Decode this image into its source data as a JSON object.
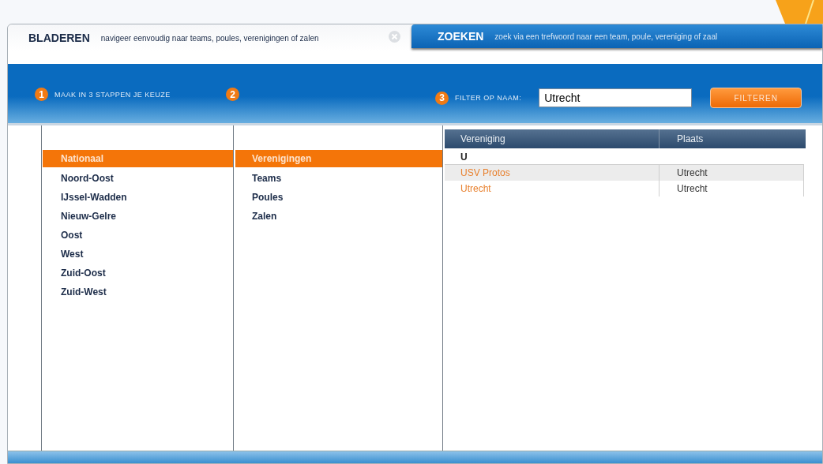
{
  "tabs": [
    {
      "title": "BLADEREN",
      "description": "navigeer eenvoudig naar teams, poules, verenigingen of zalen",
      "selected": true
    },
    {
      "title": "ZOEKEN",
      "description": "zoek via een trefwoord naar een team, poule, vereniging of zaal",
      "selected": false
    }
  ],
  "steps": [
    {
      "number": "1",
      "label": "MAAK IN 3 STAPPEN JE KEUZE"
    },
    {
      "number": "2"
    },
    {
      "number": "3",
      "label": "FILTER OP NAAM:"
    }
  ],
  "filter": {
    "value": "Utrecht",
    "button": "FILTEREN"
  },
  "regions": [
    {
      "label": "Nationaal",
      "selected": true
    },
    {
      "label": "Noord-Oost",
      "selected": false
    },
    {
      "label": "IJssel-Wadden",
      "selected": false
    },
    {
      "label": "Nieuw-Gelre",
      "selected": false
    },
    {
      "label": "Oost",
      "selected": false
    },
    {
      "label": "West",
      "selected": false
    },
    {
      "label": "Zuid-Oost",
      "selected": false
    },
    {
      "label": "Zuid-West",
      "selected": false
    }
  ],
  "categories": [
    {
      "label": "Verenigingen",
      "selected": true
    },
    {
      "label": "Teams",
      "selected": false
    },
    {
      "label": "Poules",
      "selected": false
    },
    {
      "label": "Zalen",
      "selected": false
    }
  ],
  "table": {
    "columns": [
      "Vereniging",
      "Plaats"
    ],
    "group": "U",
    "rows": [
      {
        "name": "USV Protos",
        "place": "Utrecht",
        "highlighted": true
      },
      {
        "name": "Utrecht",
        "place": "Utrecht",
        "highlighted": false
      }
    ]
  }
}
